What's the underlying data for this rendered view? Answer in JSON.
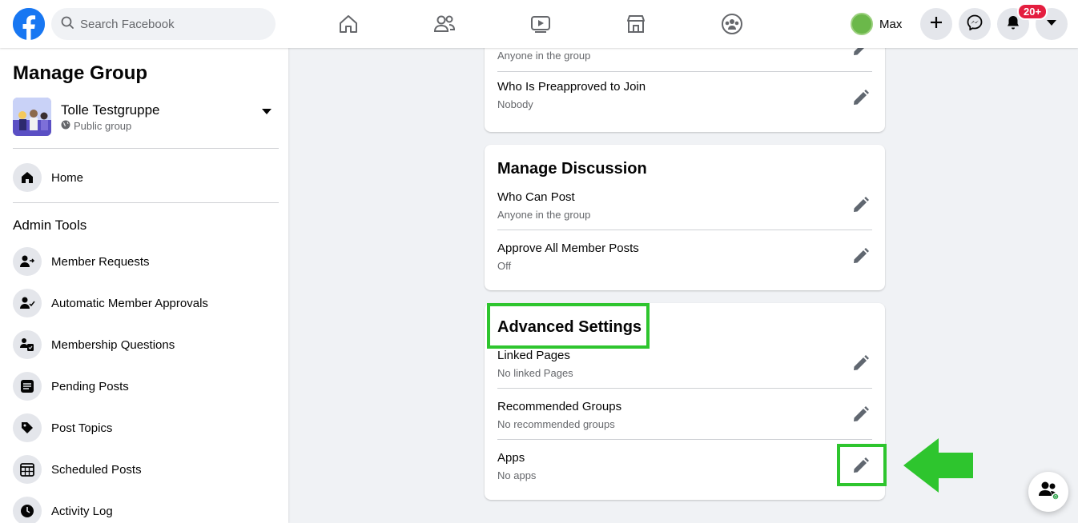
{
  "topbar": {
    "search_placeholder": "Search Facebook",
    "nav_icons": [
      "home-icon",
      "friends-icon",
      "watch-icon",
      "marketplace-icon",
      "groups-icon"
    ],
    "profile_name": "Max",
    "notification_badge": "20+"
  },
  "sidebar": {
    "title": "Manage Group",
    "group_name": "Tolle Testgruppe",
    "group_privacy": "Public group",
    "home_label": "Home",
    "section_title": "Admin Tools",
    "items": [
      {
        "label": "Member Requests",
        "icon": "member-requests-icon"
      },
      {
        "label": "Automatic Member Approvals",
        "icon": "auto-approvals-icon"
      },
      {
        "label": "Membership Questions",
        "icon": "membership-questions-icon"
      },
      {
        "label": "Pending Posts",
        "icon": "pending-posts-icon"
      },
      {
        "label": "Post Topics",
        "icon": "post-topics-icon"
      },
      {
        "label": "Scheduled Posts",
        "icon": "scheduled-posts-icon"
      },
      {
        "label": "Activity Log",
        "icon": "activity-log-icon"
      }
    ]
  },
  "main": {
    "top_card": {
      "partial_sub": "Anyone in the group",
      "rows": [
        {
          "title": "Who Is Preapproved to Join",
          "sub": "Nobody"
        }
      ]
    },
    "discussion_card": {
      "title": "Manage Discussion",
      "rows": [
        {
          "title": "Who Can Post",
          "sub": "Anyone in the group"
        },
        {
          "title": "Approve All Member Posts",
          "sub": "Off"
        }
      ]
    },
    "advanced_card": {
      "title": "Advanced Settings",
      "rows": [
        {
          "title": "Linked Pages",
          "sub": "No linked Pages"
        },
        {
          "title": "Recommended Groups",
          "sub": "No recommended groups"
        },
        {
          "title": "Apps",
          "sub": "No apps"
        }
      ]
    }
  },
  "annotations": {
    "highlight_color": "#2ec52e"
  },
  "colors": {
    "brand": "#1877f2",
    "page_bg": "#f0f2f5",
    "badge": "#e41e3f"
  }
}
